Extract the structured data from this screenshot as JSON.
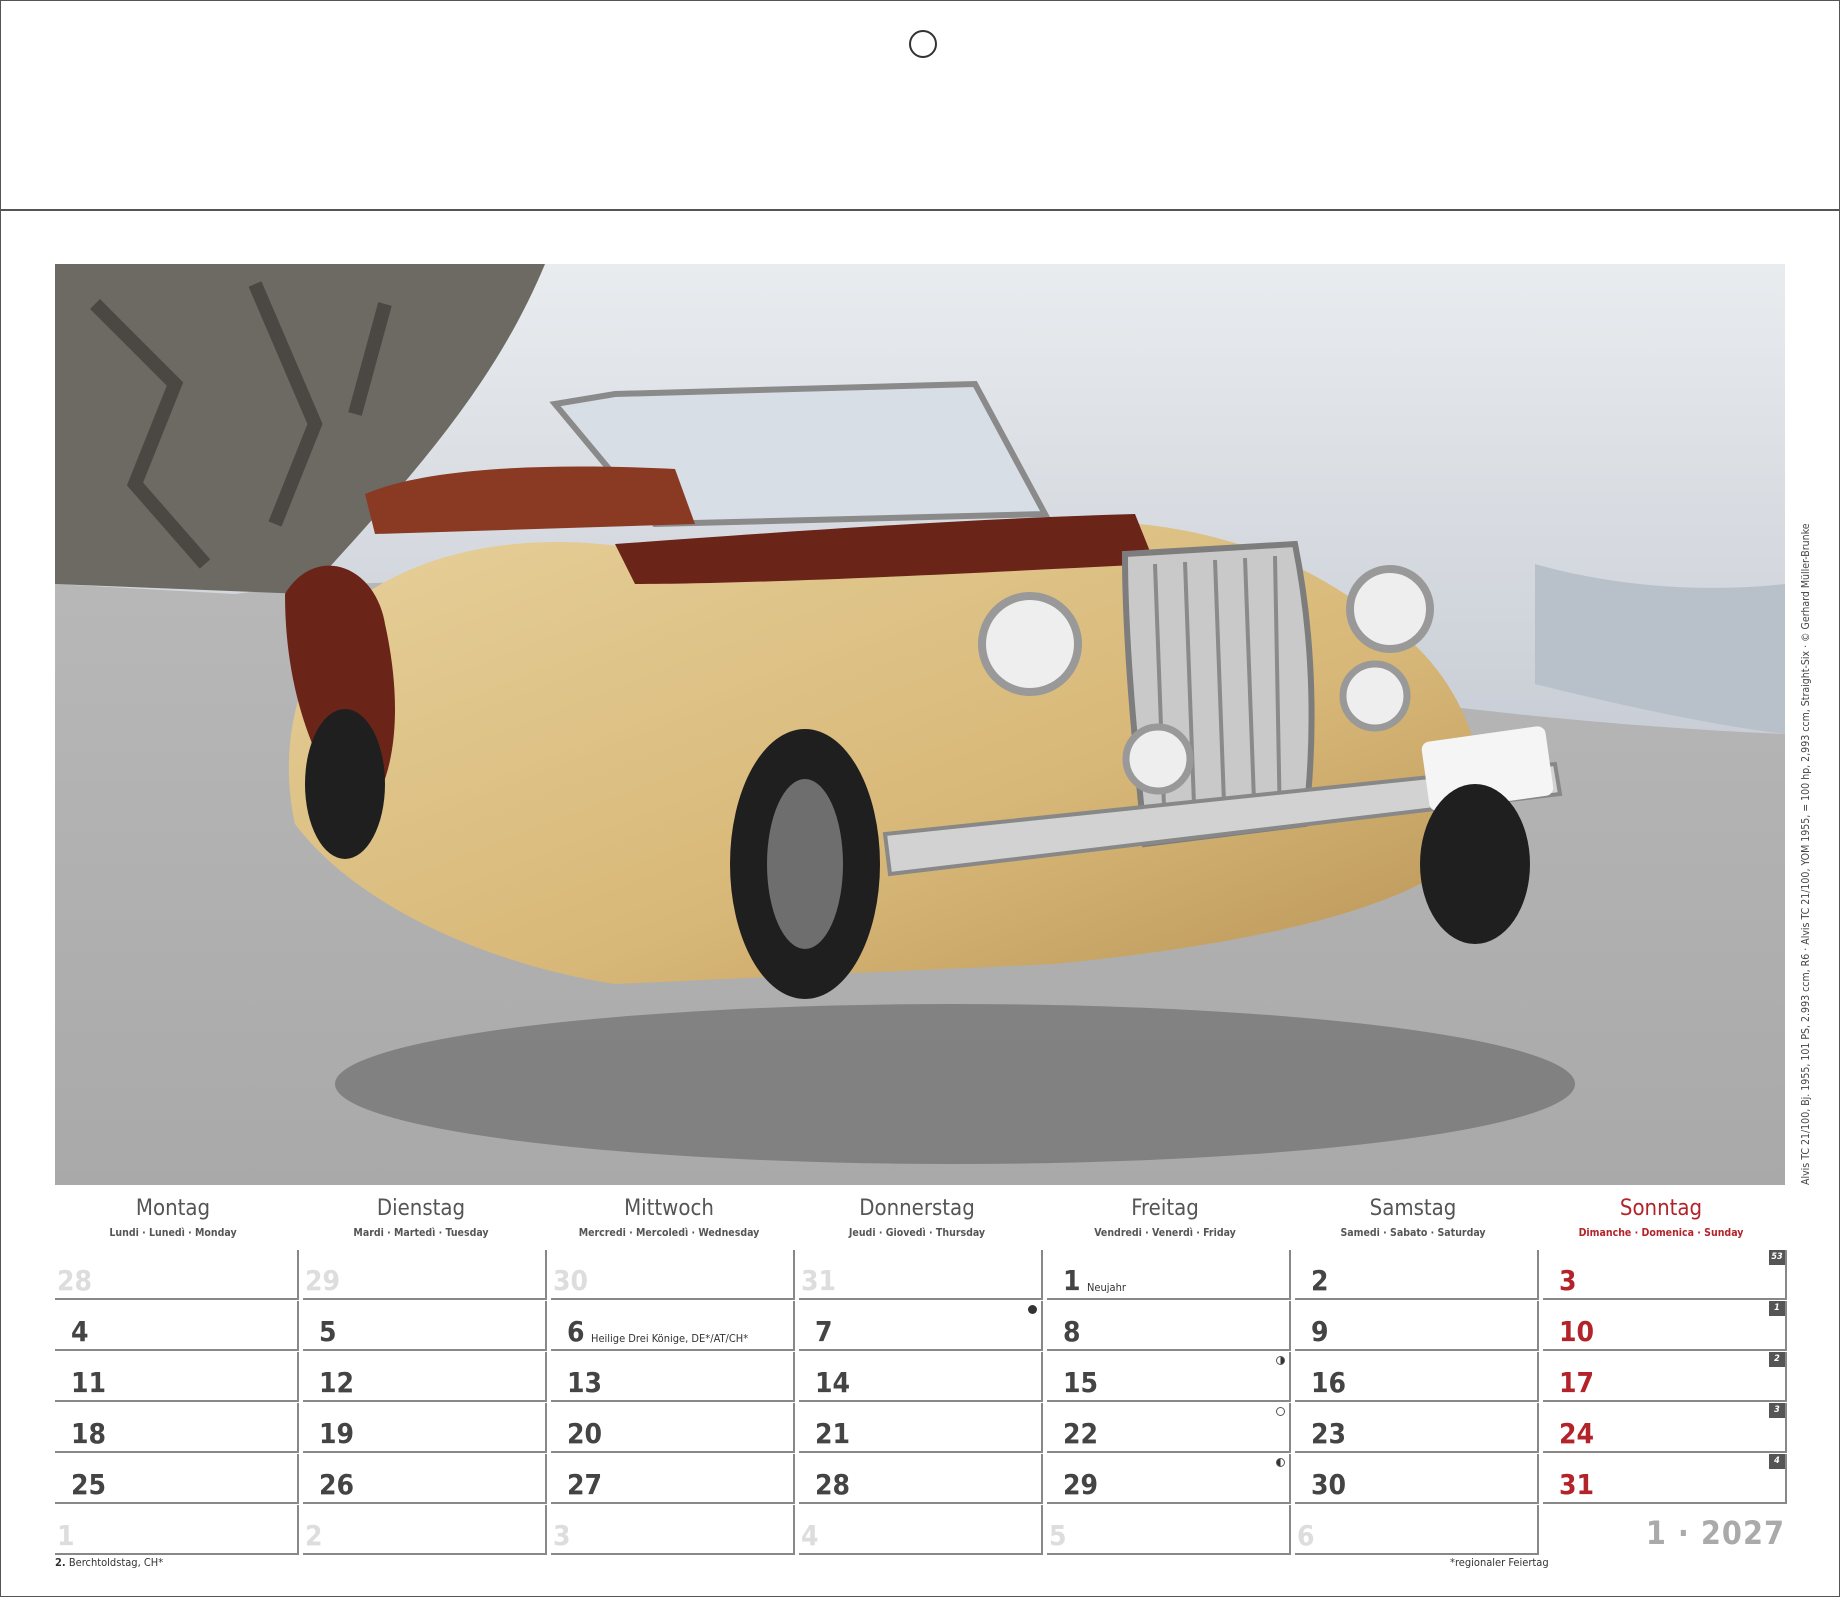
{
  "photo": {
    "caption": "Alvis TC 21/100, Bj. 1955, 101 PS, 2.993 ccm, R6 · Alvis TC 21/100, YOM 1955, = 100 hp, 2,993 ccm, Straight-Six · © Gerhard Müller-Brunke"
  },
  "weekdays": [
    {
      "name": "Montag",
      "sub": "Lundi · Lunedì · Monday"
    },
    {
      "name": "Dienstag",
      "sub": "Mardi · Martedì · Tuesday"
    },
    {
      "name": "Mittwoch",
      "sub": "Mercredi · Mercoledì · Wednesday"
    },
    {
      "name": "Donnerstag",
      "sub": "Jeudi · Giovedì · Thursday"
    },
    {
      "name": "Freitag",
      "sub": "Vendredi · Venerdì · Friday"
    },
    {
      "name": "Samstag",
      "sub": "Samedi · Sabato · Saturday"
    },
    {
      "name": "Sonntag",
      "sub": "Dimanche · Domenica · Sunday"
    }
  ],
  "weeks": [
    {
      "kw": "53",
      "days": [
        {
          "n": "28",
          "dim": true
        },
        {
          "n": "29",
          "dim": true
        },
        {
          "n": "30",
          "dim": true
        },
        {
          "n": "31",
          "dim": true
        },
        {
          "n": "1",
          "holiday": "Neujahr"
        },
        {
          "n": "2"
        },
        {
          "n": "3",
          "red": true
        }
      ]
    },
    {
      "kw": "1",
      "days": [
        {
          "n": "4"
        },
        {
          "n": "5"
        },
        {
          "n": "6",
          "holiday": "Heilige Drei Könige, DE*/AT/CH*"
        },
        {
          "n": "7",
          "moon": "new"
        },
        {
          "n": "8"
        },
        {
          "n": "9"
        },
        {
          "n": "10",
          "red": true
        }
      ]
    },
    {
      "kw": "2",
      "days": [
        {
          "n": "11"
        },
        {
          "n": "12"
        },
        {
          "n": "13"
        },
        {
          "n": "14"
        },
        {
          "n": "15",
          "moon": "first"
        },
        {
          "n": "16"
        },
        {
          "n": "17",
          "red": true
        }
      ]
    },
    {
      "kw": "3",
      "days": [
        {
          "n": "18"
        },
        {
          "n": "19"
        },
        {
          "n": "20"
        },
        {
          "n": "21"
        },
        {
          "n": "22",
          "moon": "full"
        },
        {
          "n": "23"
        },
        {
          "n": "24",
          "red": true
        }
      ]
    },
    {
      "kw": "4",
      "days": [
        {
          "n": "25"
        },
        {
          "n": "26"
        },
        {
          "n": "27"
        },
        {
          "n": "28"
        },
        {
          "n": "29",
          "moon": "last"
        },
        {
          "n": "30"
        },
        {
          "n": "31",
          "red": true
        }
      ]
    },
    {
      "kw": "",
      "days": [
        {
          "n": "1",
          "dim": true
        },
        {
          "n": "2",
          "dim": true
        },
        {
          "n": "3",
          "dim": true
        },
        {
          "n": "4",
          "dim": true
        },
        {
          "n": "5",
          "dim": true
        },
        {
          "n": "6",
          "dim": true
        }
      ]
    }
  ],
  "footnote_left": {
    "day": "2.",
    "text": "Berchtoldstag, CH*"
  },
  "footnote_right": "*regionaler Feiertag",
  "month_year": "1 · 2027",
  "colors": {
    "sunday": "#b2232a",
    "grid": "#888888",
    "dim": "#dddddd"
  }
}
